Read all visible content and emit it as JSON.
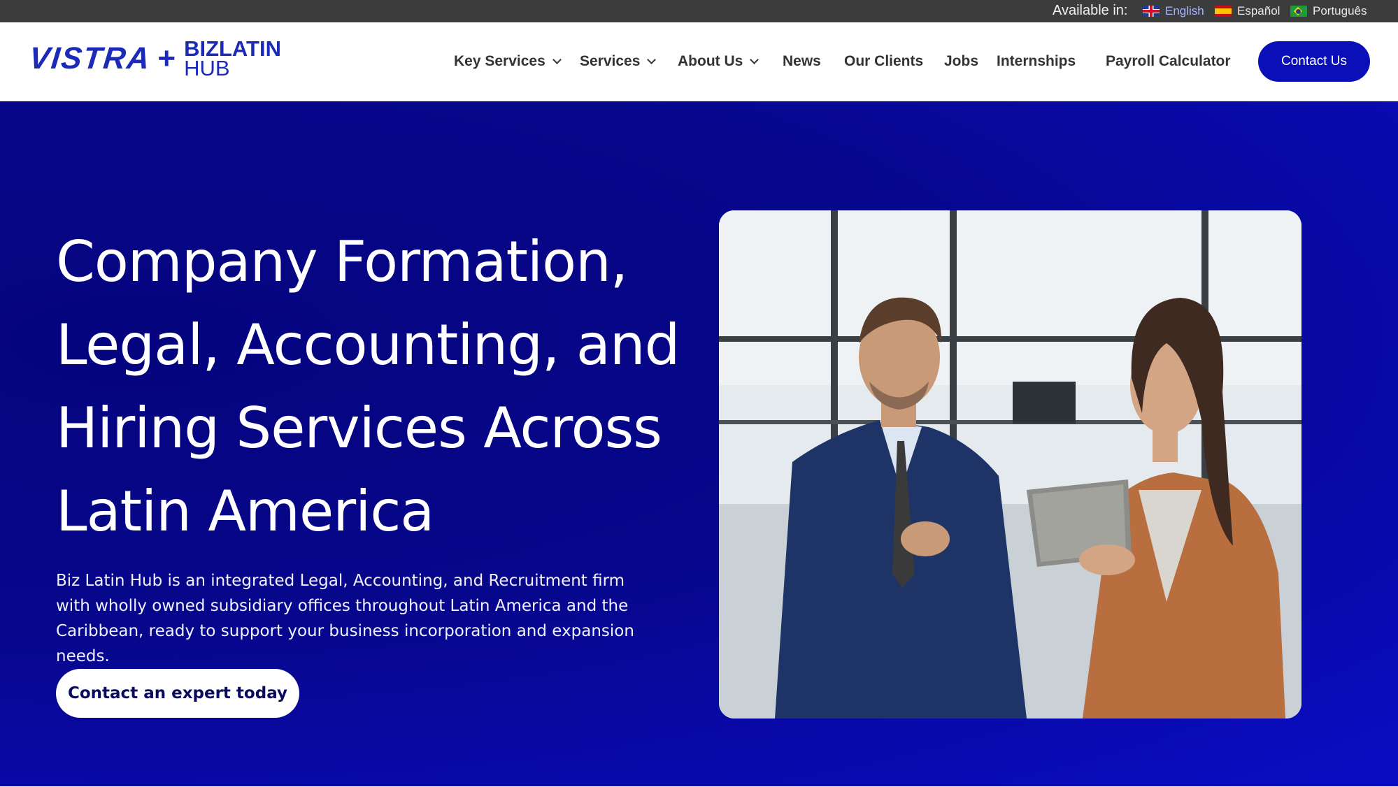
{
  "topbar": {
    "available_label": "Available in:",
    "languages": [
      {
        "label": "English",
        "flag": "uk-flag-icon",
        "active": true
      },
      {
        "label": "Español",
        "flag": "spain-flag-icon",
        "active": false
      },
      {
        "label": "Português",
        "flag": "brazil-flag-icon",
        "active": false
      }
    ]
  },
  "logo": {
    "brand": "VISTRA",
    "plus": "+",
    "biz": "BIZ",
    "latin": "LATIN",
    "hub": "HUB"
  },
  "nav": {
    "items": [
      {
        "label": "Key Services",
        "dropdown": true
      },
      {
        "label": "Services",
        "dropdown": true
      },
      {
        "label": "About Us",
        "dropdown": true
      },
      {
        "label": "News",
        "dropdown": false
      },
      {
        "label": "Our Clients",
        "dropdown": false
      },
      {
        "label": "Jobs",
        "dropdown": false
      },
      {
        "label": "Internships",
        "dropdown": false
      },
      {
        "label": "Payroll Calculator",
        "dropdown": false
      }
    ],
    "contact_label": "Contact Us"
  },
  "hero": {
    "heading_lines": [
      "Company Formation,",
      "Legal, Accounting, and",
      "Hiring Services Across",
      "Latin America"
    ],
    "description": "Biz Latin Hub is an integrated Legal, Accounting, and Recruitment firm with wholly owned subsidiary offices throughout Latin America and the Caribbean, ready to support your business incorporation and expansion needs.",
    "cta_label": "Contact an expert today"
  },
  "colors": {
    "brand_blue": "#1b2bb8",
    "hero_bg": "#07078c",
    "topbar_bg": "#3c3c3c",
    "button_blue": "#0b0fb8"
  }
}
